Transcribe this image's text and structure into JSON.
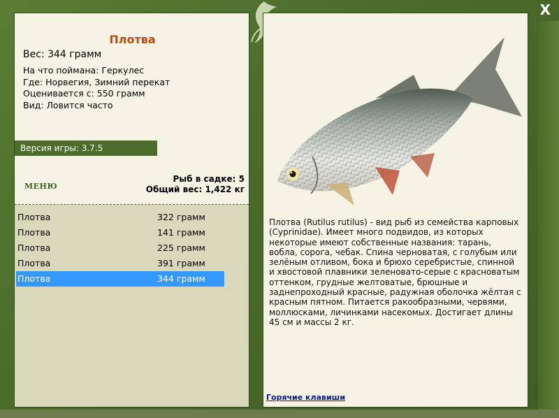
{
  "window": {
    "close_label": "X"
  },
  "fish": {
    "title": "Плотва",
    "weight_line": "Вес: 344 грамм",
    "info": [
      "На что поймана: Геркулес",
      "Где: Норвегия, Зимний перекат",
      "Оценивается с: 550 грамм",
      "Вид: Ловится часто"
    ],
    "description": "Плотва (Rutilus rutilus) - вид рыб из семейства карповых (Cyprinidae). Имеет много подвидов, из которых некоторые имеют собственные названия: тарань, вобла, сорога, чебак. Спина черноватая, с голубым или зелёным отливом, бока и брюхо серебристые, спинной и хвостовой плавники зеленовато-серые с красноватым оттенком, грудные желтоватые, брюшные и заднепроходный красные, радужная оболочка жёлтая с красным пятном. Питается ракообразными, червями, моллюсками, личинками насекомых. Достигает длины 45 см и массы 2 кг."
  },
  "game": {
    "version_label": "Версия игры: 3.7.5",
    "menu_label": "МЕНЮ"
  },
  "keepnet": {
    "count_label": "Рыб в садке: 5",
    "total_label": "Общий вес: 1,422 кг"
  },
  "catches": [
    {
      "name": "Плотва",
      "weight": "322 грамм",
      "selected": false
    },
    {
      "name": "Плотва",
      "weight": "141 грамм",
      "selected": false
    },
    {
      "name": "Плотва",
      "weight": "225 грамм",
      "selected": false
    },
    {
      "name": "Плотва",
      "weight": "391 грамм",
      "selected": false
    },
    {
      "name": "Плотва",
      "weight": "344 грамм",
      "selected": true
    }
  ],
  "links": {
    "hotkeys_label": "Горячие клавиши"
  },
  "colors": {
    "frame_green": "#4a6a2a",
    "title_orange": "#b94a10",
    "selection_blue": "#3399ff",
    "link_blue": "#0a1a8a"
  }
}
